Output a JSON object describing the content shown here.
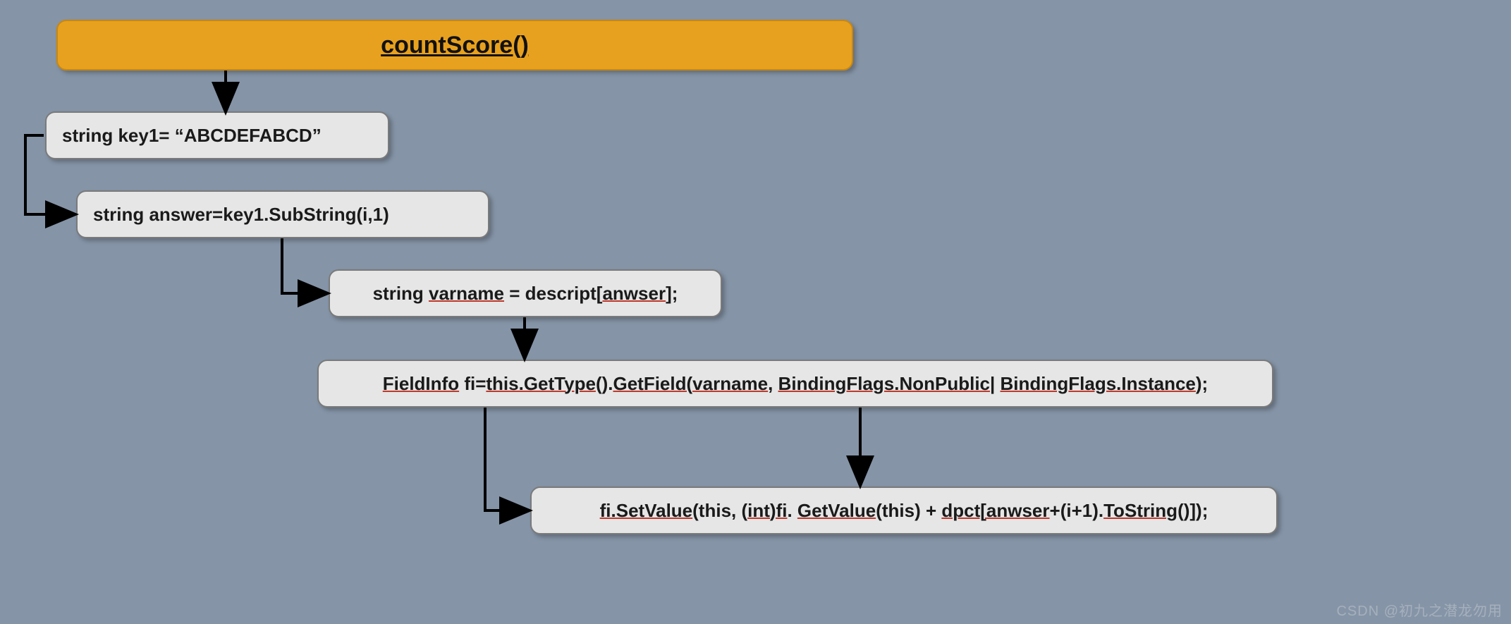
{
  "title": "countScore()",
  "nodes": {
    "n1": "string key1= “ABCDEFABCD”",
    "n2": "string answer=key1.SubString(i,1)",
    "n3_pre": "string ",
    "n3_varname": "varname",
    "n3_mid": " = descript[",
    "n3_anwser": "anwser",
    "n3_suf": "];",
    "n4_pre": "FieldInfo",
    "n4_mid1": " fi=",
    "n4_u1": "this.GetType",
    "n4_mid2": "().",
    "n4_u2": "GetField(varname",
    "n4_mid3": ", ",
    "n4_u3": "BindingFlags.NonPublic",
    "n4_mid4": "| ",
    "n4_u4": "BindingFlags.Instance",
    "n4_suf": ");",
    "n5_pre": "fi.SetValue",
    "n5_mid1": "(this, (",
    "n5_u1": "int)fi",
    "n5_mid2": ". ",
    "n5_u2": "GetValue",
    "n5_mid3": "(this) + ",
    "n5_u3": "dpct[anwser",
    "n5_mid4": "+(i+1).",
    "n5_u4": "ToString",
    "n5_suf": "()]);"
  },
  "watermark": "CSDN @初九之潜龙勿用"
}
